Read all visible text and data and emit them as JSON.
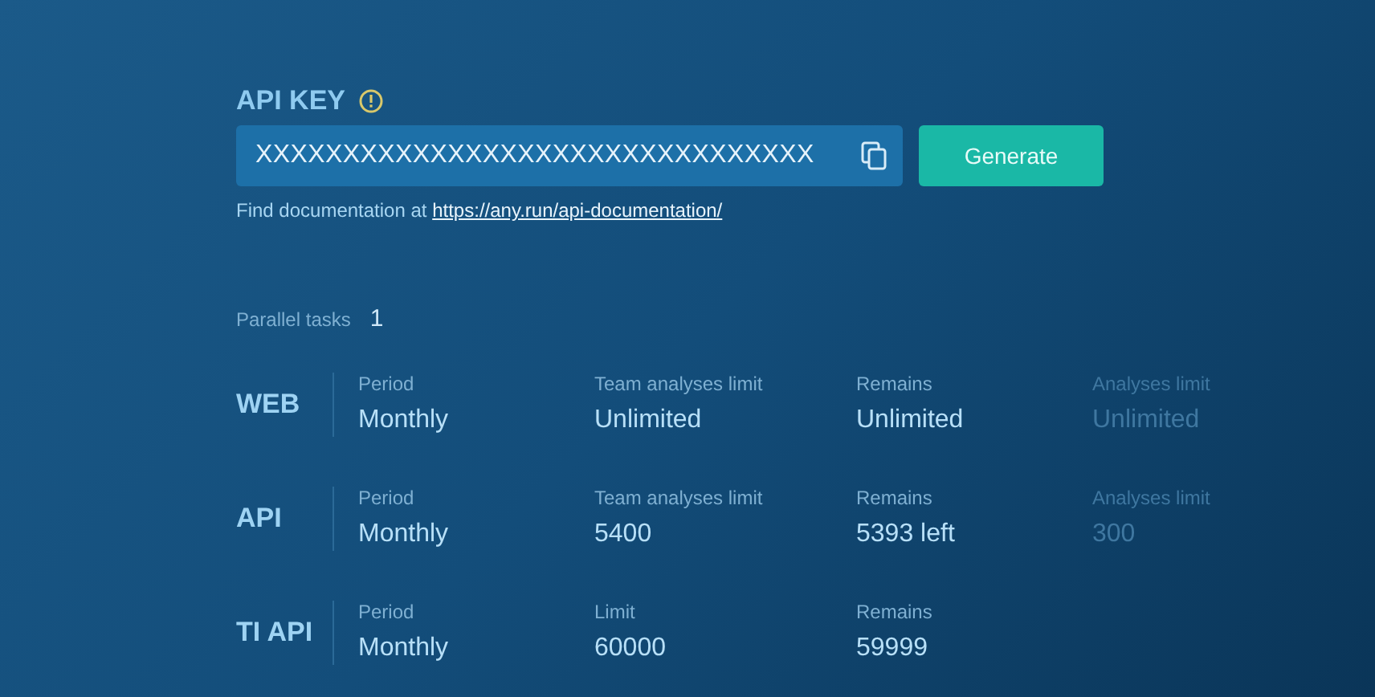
{
  "api_key": {
    "label": "API KEY",
    "value": "XXXXXXXXXXXXXXXXXXXXXXXXXXXXXXXX",
    "button": "Generate"
  },
  "documentation": {
    "text": "Find documentation at",
    "link": "https://any.run/api-documentation/"
  },
  "parallel_tasks": {
    "label": "Parallel tasks",
    "value": "1"
  },
  "plans": [
    {
      "name": "WEB",
      "fields": [
        {
          "label": "Period",
          "value": "Monthly",
          "disabled": false
        },
        {
          "label": "Team analyses limit",
          "value": "Unlimited",
          "disabled": false
        },
        {
          "label": "Remains",
          "value": "Unlimited",
          "disabled": false
        },
        {
          "label": "Analyses limit",
          "value": "Unlimited",
          "disabled": true
        }
      ]
    },
    {
      "name": "API",
      "fields": [
        {
          "label": "Period",
          "value": "Monthly",
          "disabled": false
        },
        {
          "label": "Team analyses limit",
          "value": "5400",
          "disabled": false
        },
        {
          "label": "Remains",
          "value": "5393 left",
          "disabled": false
        },
        {
          "label": "Analyses limit",
          "value": "300",
          "disabled": true
        }
      ]
    },
    {
      "name": "TI API",
      "fields": [
        {
          "label": "Period",
          "value": "Monthly",
          "disabled": false
        },
        {
          "label": "Limit",
          "value": "60000",
          "disabled": false
        },
        {
          "label": "Remains",
          "value": "59999",
          "disabled": false
        }
      ]
    }
  ]
}
